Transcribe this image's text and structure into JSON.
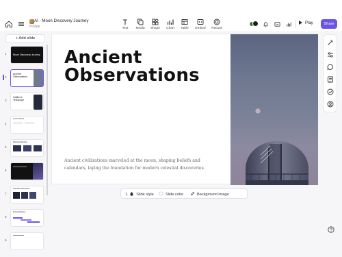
{
  "app": {
    "title": "AI - Moon Discovery Journey",
    "subtitle": "Private"
  },
  "toolbar": {
    "tools": [
      {
        "label": "Text",
        "icon": "text-icon"
      },
      {
        "label": "Media",
        "icon": "media-icon"
      },
      {
        "label": "Shape",
        "icon": "shape-icon"
      },
      {
        "label": "Chart",
        "icon": "chart-icon"
      },
      {
        "label": "Table",
        "icon": "table-icon"
      },
      {
        "label": "Embed",
        "icon": "embed-icon"
      },
      {
        "label": "Record",
        "icon": "record-icon"
      }
    ],
    "play_label": "Play",
    "share_label": "Share"
  },
  "sidebar": {
    "add_slide_label": "+ Add slide",
    "selected_slide": 2,
    "slides": [
      {
        "number": "1",
        "title": "Moon Discovery Journey"
      },
      {
        "number": "2",
        "title": "Ancient Observations"
      },
      {
        "number": "3",
        "title": "Galileo's Telescope"
      },
      {
        "number": "4",
        "title": "Lunar Phases"
      },
      {
        "number": "5",
        "title": "Space Exploration"
      },
      {
        "number": "6",
        "title": ""
      },
      {
        "number": "7",
        "title": "Scientific Discoveries"
      },
      {
        "number": "8",
        "title": "Future Missions"
      },
      {
        "number": "9",
        "title": ""
      }
    ]
  },
  "slide": {
    "title_line1": "Ancient",
    "title_line2": "Observations",
    "body": "Ancient civilizations marveled at the moon, shaping beliefs and calendars, laying the foundation for modern celestial discoveries."
  },
  "format_toolbar": {
    "slide_number": "1.",
    "slide_style_label": "Slide style",
    "slide_color_label": "Slide color",
    "background_image_label": "Background image"
  },
  "right_panel": {
    "icons": [
      "magic-wand-icon",
      "sliders-icon",
      "comment-icon",
      "notes-icon",
      "checklist-icon",
      "user-icon"
    ]
  },
  "colors": {
    "accent": "#6a55e6",
    "sky_top": "#5b6580",
    "sky_bottom": "#8f8499"
  }
}
